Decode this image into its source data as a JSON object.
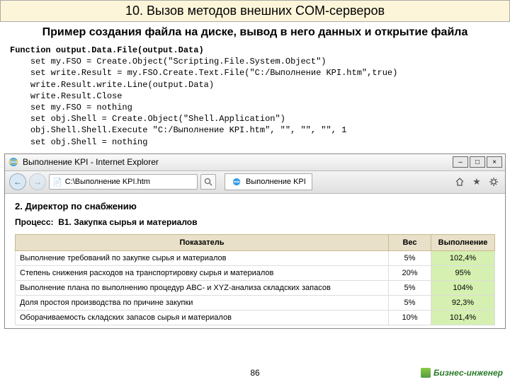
{
  "header": {
    "title": "10. Вызов методов внешних COM-серверов",
    "subtitle": "Пример создания файла на диске, вывод в него данных и открытие файла"
  },
  "code": {
    "signature": "Function output.Data.File(output.Data)",
    "lines": [
      "set my.FSO = Create.Object(\"Scripting.File.System.Object\")",
      "set write.Result = my.FSO.Create.Text.File(\"C:/Выполнение KPI.htm\",true)",
      "write.Result.write.Line(output.Data)",
      "write.Result.Close",
      "set my.FSO = nothing",
      "set obj.Shell = Create.Object(\"Shell.Application\")",
      "obj.Shell.Shell.Execute \"C:/Выполнение KPI.htm\", \"\", \"\", \"\", 1",
      "set obj.Shell = nothing"
    ]
  },
  "browser": {
    "windowTitle": "Выполнение KPI - Internet Explorer",
    "address": "C:\\Выполнение KPI.htm",
    "tabLabel": "Выполнение KPI"
  },
  "content": {
    "sectionHead": "2. Директор по снабжению",
    "processLabel": "Процесс:",
    "processValue": "В1. Закупка сырья и материалов",
    "columns": {
      "c1": "Показатель",
      "c2": "Вес",
      "c3": "Выполнение"
    },
    "rows": [
      {
        "label": "Выполнение требований по закупке сырья и материалов",
        "weight": "5%",
        "value": "102,4%"
      },
      {
        "label": "Степень снижения расходов на транспортировку сырья и материалов",
        "weight": "20%",
        "value": "95%"
      },
      {
        "label": "Выполнение плана по выполнению процедур ABC- и XYZ-анализа складских запасов",
        "weight": "5%",
        "value": "104%"
      },
      {
        "label": "Доля простоя производства по причине закупки",
        "weight": "5%",
        "value": "92,3%"
      },
      {
        "label": "Оборачиваемость складских запасов сырья и материалов",
        "weight": "10%",
        "value": "101,4%"
      }
    ]
  },
  "footer": {
    "pageNum": "86",
    "brand": "Бизнес-инженер"
  }
}
